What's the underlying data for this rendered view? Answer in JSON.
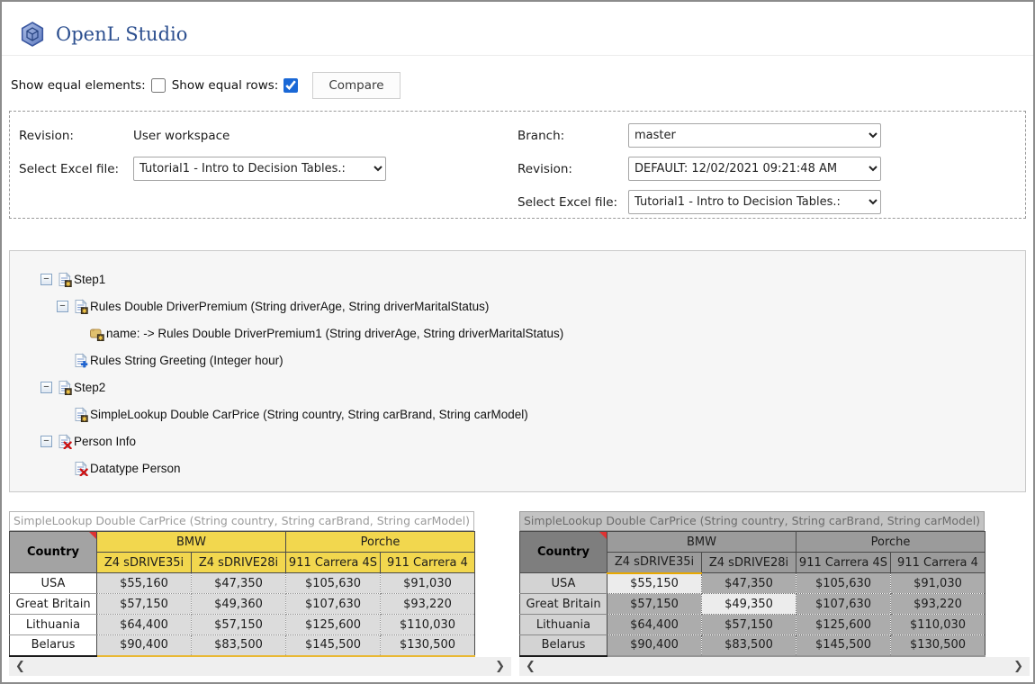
{
  "app": {
    "title": "OpenL Studio"
  },
  "toolbar": {
    "show_equal_elements_label": "Show equal elements:",
    "show_equal_elements_checked": false,
    "show_equal_rows_label": "Show equal rows:",
    "show_equal_rows_checked": true,
    "compare_label": "Compare"
  },
  "selection_panel": {
    "left": {
      "revision_label": "Revision:",
      "revision_value": "User workspace",
      "file_label": "Select Excel file:",
      "file_value": "Tutorial1 - Intro to Decision Tables.:"
    },
    "right": {
      "branch_label": "Branch:",
      "branch_value": "master",
      "revision_label": "Revision:",
      "revision_value": "DEFAULT: 12/02/2021 09:21:48 AM",
      "file_label": "Select Excel file:",
      "file_value": "Tutorial1 - Intro to Decision Tables.:"
    }
  },
  "tree": {
    "items": [
      {
        "label": "Step1",
        "icon": "sheet-modified-icon",
        "level": 1,
        "expander": true
      },
      {
        "label": "Rules Double DriverPremium (String driverAge, String driverMaritalStatus)",
        "icon": "sheet-modified-icon",
        "level": 2,
        "expander": true
      },
      {
        "label": "name: -> Rules Double DriverPremium1 (String driverAge, String driverMaritalStatus)",
        "icon": "property-modified-icon",
        "level": 3,
        "expander": false
      },
      {
        "label": "Rules String Greeting (Integer hour)",
        "icon": "sheet-added-icon",
        "level": 2,
        "expander": false
      },
      {
        "label": "Step2",
        "icon": "sheet-modified-icon",
        "level": 1,
        "expander": true
      },
      {
        "label": "SimpleLookup Double CarPrice (String country, String carBrand, String carModel)",
        "icon": "sheet-modified-icon",
        "level": 2,
        "expander": false
      },
      {
        "label": "Person Info",
        "icon": "sheet-deleted-icon",
        "level": 1,
        "expander": true
      },
      {
        "label": "Datatype Person",
        "icon": "sheet-deleted-icon",
        "level": 2,
        "expander": false
      }
    ]
  },
  "tables": {
    "left": {
      "title": "SimpleLookup Double CarPrice (String country, String carBrand, String carModel)",
      "corner_header": "Country",
      "brands": [
        {
          "label": "BMW",
          "span": 2
        },
        {
          "label": "Porche",
          "span": 2
        }
      ],
      "models": [
        "Z4 sDRIVE35i",
        "Z4 sDRIVE28i",
        "911 Carrera 4S",
        "911 Carrera 4"
      ],
      "rows": [
        {
          "country": "USA",
          "values": [
            "$55,160",
            "$47,350",
            "$105,630",
            "$91,030"
          ]
        },
        {
          "country": "Great Britain",
          "values": [
            "$57,150",
            "$49,360",
            "$107,630",
            "$93,220"
          ]
        },
        {
          "country": "Lithuania",
          "values": [
            "$64,400",
            "$57,150",
            "$125,600",
            "$110,030"
          ]
        },
        {
          "country": "Belarus",
          "values": [
            "$90,400",
            "$83,500",
            "$145,500",
            "$130,500"
          ]
        }
      ]
    },
    "right": {
      "title": "SimpleLookup Double CarPrice (String country, String carBrand, String carModel)",
      "corner_header": "Country",
      "brands": [
        {
          "label": "BMW",
          "span": 2
        },
        {
          "label": "Porche",
          "span": 2
        }
      ],
      "models": [
        "Z4 sDRIVE35i",
        "Z4 sDRIVE28i",
        "911 Carrera 4S",
        "911 Carrera 4"
      ],
      "rows": [
        {
          "country": "USA",
          "values": [
            "$55,150",
            "$47,350",
            "$105,630",
            "$91,030"
          ]
        },
        {
          "country": "Great Britain",
          "values": [
            "$57,150",
            "$49,350",
            "$107,630",
            "$93,220"
          ]
        },
        {
          "country": "Lithuania",
          "values": [
            "$64,400",
            "$57,150",
            "$125,600",
            "$110,030"
          ]
        },
        {
          "country": "Belarus",
          "values": [
            "$90,400",
            "$83,500",
            "$145,500",
            "$130,500"
          ]
        }
      ],
      "changed_cells": [
        [
          0,
          0
        ],
        [
          1,
          1
        ]
      ]
    }
  },
  "icons": {
    "expander_collapsed": "−",
    "scroll_left": "❮",
    "scroll_right": "❯"
  },
  "colors": {
    "brand_blue": "#2c4f8f",
    "header_yellow": "#f2d74e",
    "diff_highlight": "#ececec",
    "diff_border_orange": "#e8a800",
    "checkbox_accent": "#1a68d6",
    "deleted_red": "#cc1111",
    "added_blue": "#1e63d0"
  }
}
